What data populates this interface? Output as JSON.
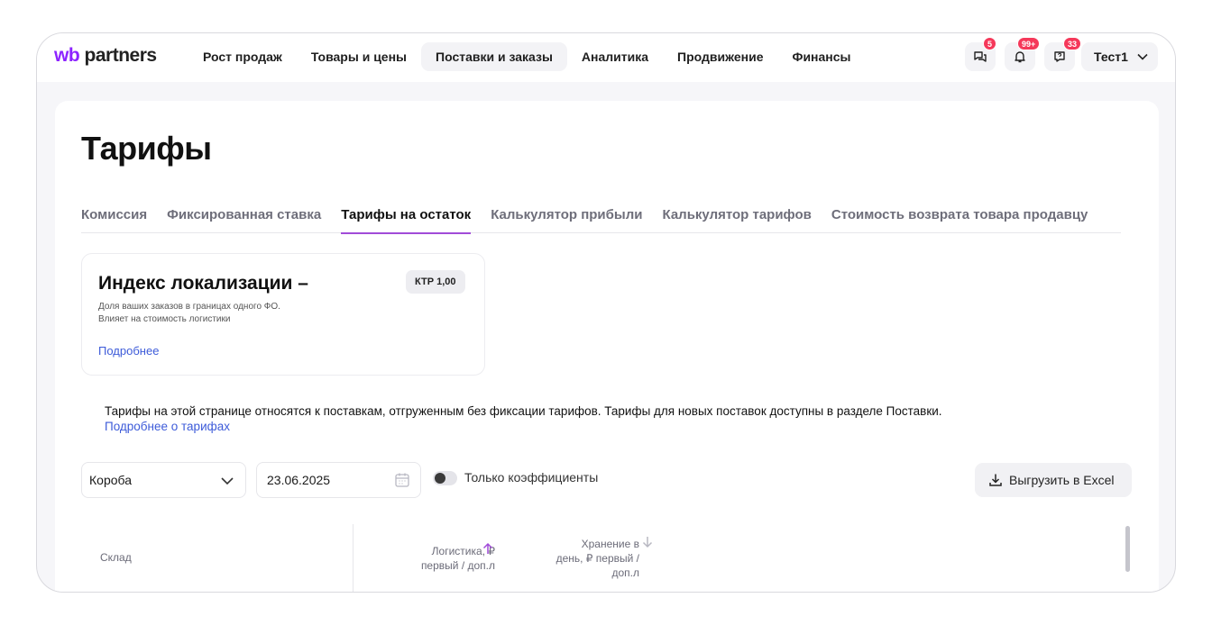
{
  "header": {
    "logo_wb": "wb",
    "logo_rest": "partners",
    "nav": [
      {
        "label": "Рост продаж"
      },
      {
        "label": "Товары и цены"
      },
      {
        "label": "Поставки и заказы"
      },
      {
        "label": "Аналитика"
      },
      {
        "label": "Продвижение"
      },
      {
        "label": "Финансы"
      }
    ],
    "active_nav": "Поставки и заказы",
    "icons": [
      {
        "name": "chat-icon",
        "badge": "5"
      },
      {
        "name": "bell-icon",
        "badge": "99+"
      },
      {
        "name": "help-chat-icon",
        "badge": "33"
      }
    ],
    "user": "Тест1"
  },
  "page": {
    "title": "Тарифы",
    "tabs": [
      {
        "label": "Комиссия"
      },
      {
        "label": "Фиксированная ставка"
      },
      {
        "label": "Тарифы на остаток"
      },
      {
        "label": "Калькулятор прибыли"
      },
      {
        "label": "Калькулятор тарифов"
      },
      {
        "label": "Стоимость возврата товара продавцу"
      }
    ],
    "active_tab": "Тарифы на остаток"
  },
  "localization": {
    "title": "Индекс локализации –",
    "ktr": "КТР 1,00",
    "description_1": "Доля ваших заказов в границах одного ФО.",
    "description_2": "Влияет на стоимость логистики",
    "more": "Подробнее"
  },
  "notice": {
    "text": "Тарифы на этой странице относятся к поставкам, отгруженным без фиксации тарифов. Тарифы для новых поставок доступны в разделе Поставки.",
    "link": "Подробнее о тарифах"
  },
  "filters": {
    "box_type": "Короба",
    "date": "23.06.2025",
    "toggle_label": "Только коэффициенты",
    "toggle_on": false,
    "export": "Выгрузить в Excel"
  },
  "table": {
    "col_warehouse": "Склад",
    "col_logistics_1": "Логистика, ₽",
    "col_logistics_2": "первый / доп.л",
    "col_storage_1": "Хранение в",
    "col_storage_2": "день, ₽ первый /",
    "col_storage_3": "доп.л"
  },
  "colors": {
    "accent": "#a14bd8",
    "link": "#3d5bd9",
    "badge": "#f5385a"
  }
}
